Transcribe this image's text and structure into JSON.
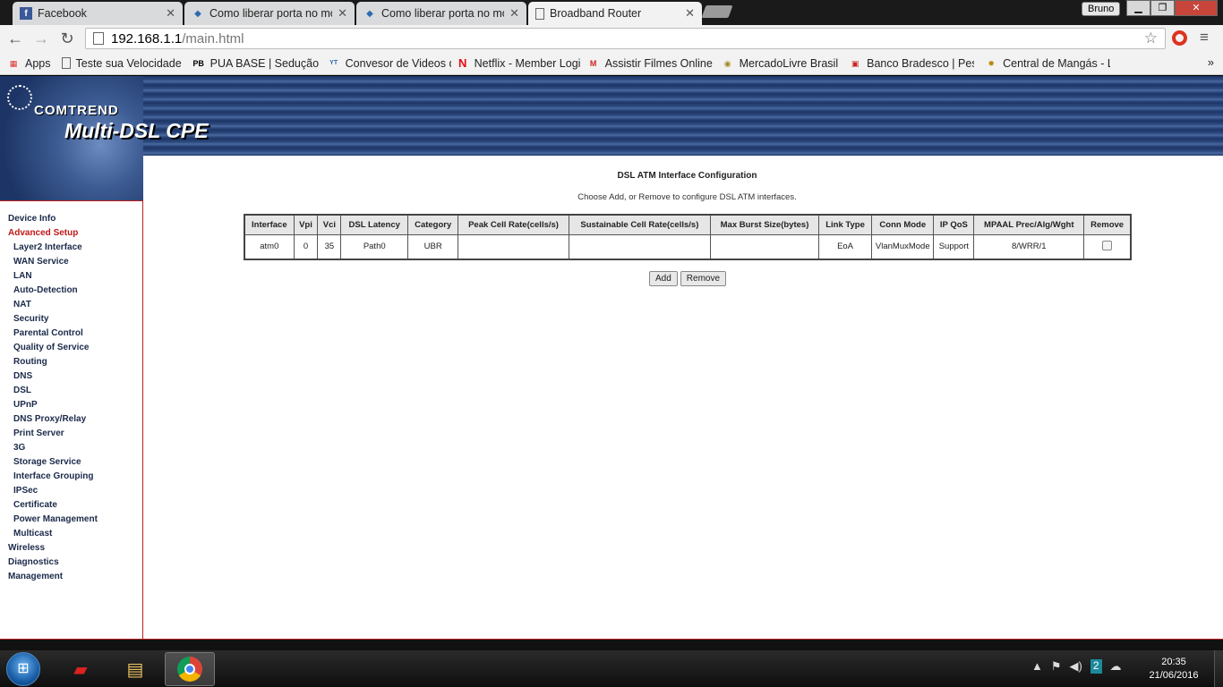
{
  "browser": {
    "tabs": [
      {
        "title": "Facebook",
        "icon": "facebook-icon"
      },
      {
        "title": "Como liberar porta no mo",
        "icon": "forum-icon"
      },
      {
        "title": "Como liberar porta no mo",
        "icon": "forum-icon"
      },
      {
        "title": "Broadband Router",
        "icon": "page-icon",
        "active": true
      }
    ],
    "profile": "Bruno",
    "url_host": "192.168.1.1",
    "url_path": "/main.html",
    "bookmarks": [
      {
        "label": "Apps",
        "icon": "apps-grid-icon"
      },
      {
        "label": "Teste sua Velocidade",
        "icon": "page-icon"
      },
      {
        "label": "PUA BASE | Sedução |",
        "icon": "pua-icon"
      },
      {
        "label": "Convesor de Videos d",
        "icon": "yt-mp3-icon"
      },
      {
        "label": "Netflix - Member Logi",
        "icon": "netflix-icon"
      },
      {
        "label": "Assistir Filmes Online",
        "icon": "mega-filmes-icon"
      },
      {
        "label": "MercadoLivre Brasil",
        "icon": "mercadolivre-icon"
      },
      {
        "label": "Banco Bradesco | Pess",
        "icon": "bradesco-icon"
      },
      {
        "label": "Central de Mangás - L",
        "icon": "manga-icon"
      }
    ]
  },
  "router": {
    "brand": "COMTREND",
    "product": "Multi-DSL CPE",
    "nav": [
      {
        "label": "Device Info",
        "level": 0
      },
      {
        "label": "Advanced Setup",
        "level": 0,
        "active": true
      },
      {
        "label": "Layer2 Interface",
        "level": 1
      },
      {
        "label": "WAN Service",
        "level": 1
      },
      {
        "label": "LAN",
        "level": 1
      },
      {
        "label": "Auto-Detection",
        "level": 1
      },
      {
        "label": "NAT",
        "level": 1
      },
      {
        "label": "Security",
        "level": 1
      },
      {
        "label": "Parental Control",
        "level": 1
      },
      {
        "label": "Quality of Service",
        "level": 1
      },
      {
        "label": "Routing",
        "level": 1
      },
      {
        "label": "DNS",
        "level": 1
      },
      {
        "label": "DSL",
        "level": 1
      },
      {
        "label": "UPnP",
        "level": 1
      },
      {
        "label": "DNS Proxy/Relay",
        "level": 1
      },
      {
        "label": "Print Server",
        "level": 1
      },
      {
        "label": "3G",
        "level": 1
      },
      {
        "label": "Storage Service",
        "level": 1
      },
      {
        "label": "Interface Grouping",
        "level": 1
      },
      {
        "label": "IPSec",
        "level": 1
      },
      {
        "label": "Certificate",
        "level": 1
      },
      {
        "label": "Power Management",
        "level": 1
      },
      {
        "label": "Multicast",
        "level": 1
      },
      {
        "label": "Wireless",
        "level": 0
      },
      {
        "label": "Diagnostics",
        "level": 0
      },
      {
        "label": "Management",
        "level": 0
      }
    ],
    "page_title": "DSL ATM Interface Configuration",
    "page_desc": "Choose Add, or Remove to configure DSL ATM interfaces.",
    "table": {
      "columns": [
        "Interface",
        "Vpi",
        "Vci",
        "DSL Latency",
        "Category",
        "Peak Cell Rate(cells/s)",
        "Sustainable Cell Rate(cells/s)",
        "Max Burst Size(bytes)",
        "Link Type",
        "Conn Mode",
        "IP QoS",
        "MPAAL Prec/Alg/Wght",
        "Remove"
      ],
      "rows": [
        [
          "atm0",
          "0",
          "35",
          "Path0",
          "UBR",
          "",
          "",
          "",
          "EoA",
          "VlanMuxMode",
          "Support",
          "8/WRR/1",
          ""
        ]
      ]
    },
    "add_label": "Add",
    "remove_label": "Remove"
  },
  "taskbar": {
    "apps": [
      "red-app-icon",
      "file-explorer-icon",
      "chrome-icon"
    ],
    "tray_badge": "2",
    "time": "20:35",
    "date": "21/06/2016"
  }
}
